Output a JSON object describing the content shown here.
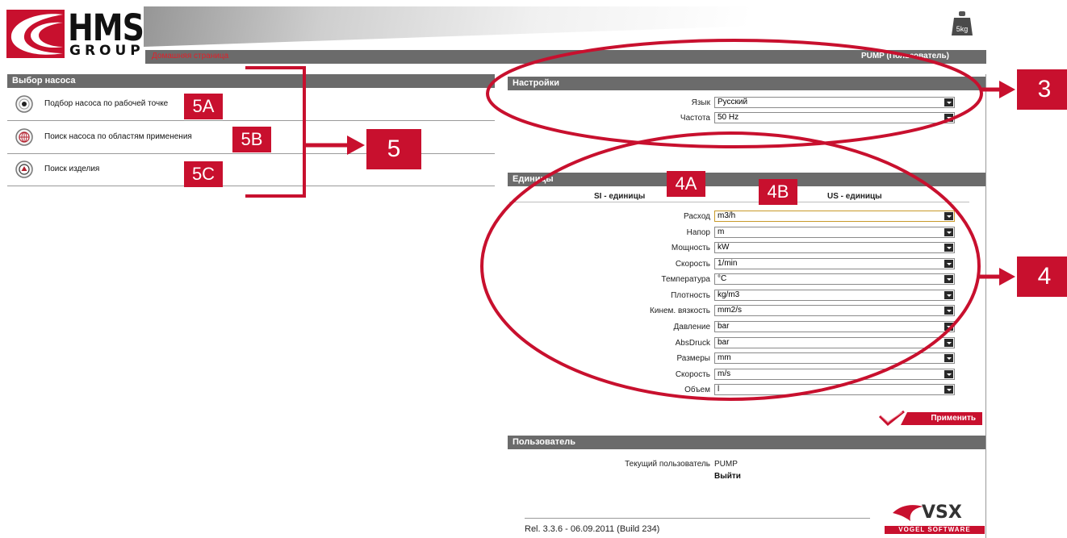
{
  "header": {
    "logo_hms": "HMS",
    "logo_group": "GROUP",
    "home_link": "Домашняя страница",
    "user_label": "PUMP (Пользователь)"
  },
  "left": {
    "title": "Выбор насоса",
    "items": [
      {
        "label": "Подбор насоса по рабочей точке",
        "icon": "target-icon"
      },
      {
        "label": "Поиск насоса по областям применения",
        "icon": "globe-icon"
      },
      {
        "label": "Поиск изделия",
        "icon": "search-product-icon"
      }
    ]
  },
  "settings": {
    "title": "Настройки",
    "language_label": "Язык",
    "language_value": "Русский",
    "frequency_label": "Частота",
    "frequency_value": "50 Hz"
  },
  "units": {
    "title": "Единицы",
    "si_heading": "SI - единицы",
    "us_heading": "US - единицы",
    "rows": [
      {
        "label": "Расход",
        "value": "m3/h"
      },
      {
        "label": "Напор",
        "value": "m"
      },
      {
        "label": "Мощность",
        "value": "kW"
      },
      {
        "label": "Скорость",
        "value": "1/min"
      },
      {
        "label": "Температура",
        "value": "°C"
      },
      {
        "label": "Плотность",
        "value": "kg/m3"
      },
      {
        "label": "Кинем. вязкость",
        "value": "mm2/s"
      },
      {
        "label": "Давление",
        "value": "bar"
      },
      {
        "label": "AbsDruck",
        "value": "bar"
      },
      {
        "label": "Размеры",
        "value": "mm"
      },
      {
        "label": "Скорость",
        "value": "m/s"
      },
      {
        "label": "Объем",
        "value": "l"
      }
    ],
    "apply_label": "Применить"
  },
  "user": {
    "title": "Пользователь",
    "current_label": "Текущий пользователь",
    "current_value": "PUMP",
    "logout_label": "Выйти"
  },
  "footer": {
    "release": "Rel. 3.3.6 - 06.09.2011 (Build 234)",
    "vsx_brand": "VSX",
    "vsx_sub": "VOGEL SOFTWARE"
  },
  "annotations": {
    "tag_3": "3",
    "tag_4": "4",
    "tag_4a": "4A",
    "tag_4b": "4B",
    "tag_5": "5",
    "tag_5a": "5A",
    "tag_5b": "5B",
    "tag_5c": "5C",
    "accent_color": "#c8102e"
  },
  "icons": {
    "weight": "weight-5kg-icon"
  }
}
